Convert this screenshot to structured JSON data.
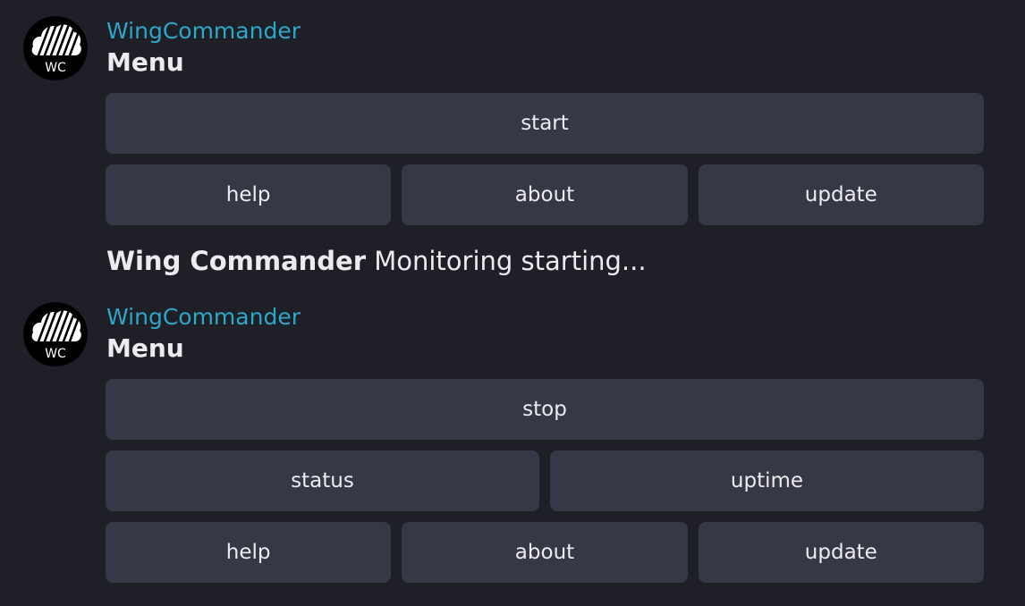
{
  "messages": [
    {
      "sender": "WingCommander",
      "title": "Menu",
      "avatar": {
        "text": "WC",
        "icon": "cloud-stripes-logo"
      },
      "rows": [
        [
          "start"
        ],
        [
          "help",
          "about",
          "update"
        ]
      ]
    },
    {
      "sender": "WingCommander",
      "title": "Menu",
      "avatar": {
        "text": "WC",
        "icon": "cloud-stripes-logo"
      },
      "rows": [
        [
          "stop"
        ],
        [
          "status",
          "uptime"
        ],
        [
          "help",
          "about",
          "update"
        ]
      ]
    }
  ],
  "status_message": {
    "bold": "Wing Commander",
    "text": "Monitoring starting..."
  },
  "colors": {
    "background": "#1f1f27",
    "button": "#373845",
    "sender": "#2ea6c8",
    "text": "#ececf0"
  }
}
